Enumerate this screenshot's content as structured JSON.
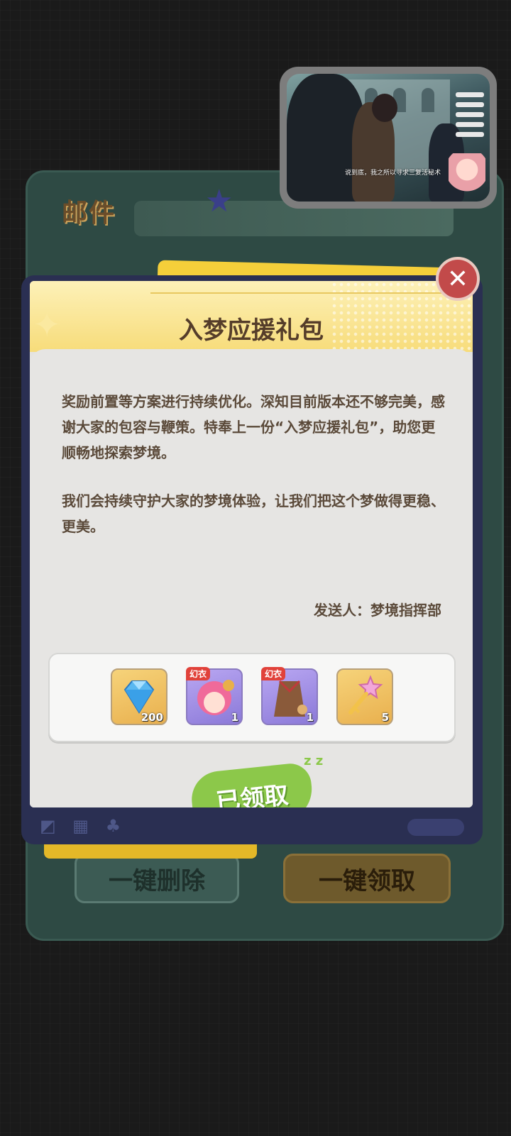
{
  "mail": {
    "title": "邮件",
    "delete_all": "一键删除",
    "claim_all": "一键领取"
  },
  "modal": {
    "title": "入梦应援礼包",
    "paragraph1": "奖励前置等方案进行持续优化。深知目前版本还不够完美，感谢大家的包容与鞭策。特奉上一份“入梦应援礼包”，助您更顺畅地探索梦境。",
    "paragraph2": "我们会持续守护大家的梦境体验，让我们把这个梦做得更稳、更美。",
    "sender": "发送人：梦境指挥部",
    "claimed_label": "已领取",
    "rewards": [
      {
        "icon": "diamond-icon",
        "count": "200",
        "badge": ""
      },
      {
        "icon": "pink-hair-avatar-icon",
        "count": "1",
        "badge": "幻衣"
      },
      {
        "icon": "coat-outfit-icon",
        "count": "1",
        "badge": "幻衣"
      },
      {
        "icon": "star-key-icon",
        "count": "5",
        "badge": ""
      }
    ]
  },
  "video": {
    "subtitle": "说到底，我之所以寻求三复活秘术"
  },
  "colors": {
    "accent_green": "#8cc84a",
    "close_red": "#c24a4a",
    "title_brown": "#553d2a"
  }
}
